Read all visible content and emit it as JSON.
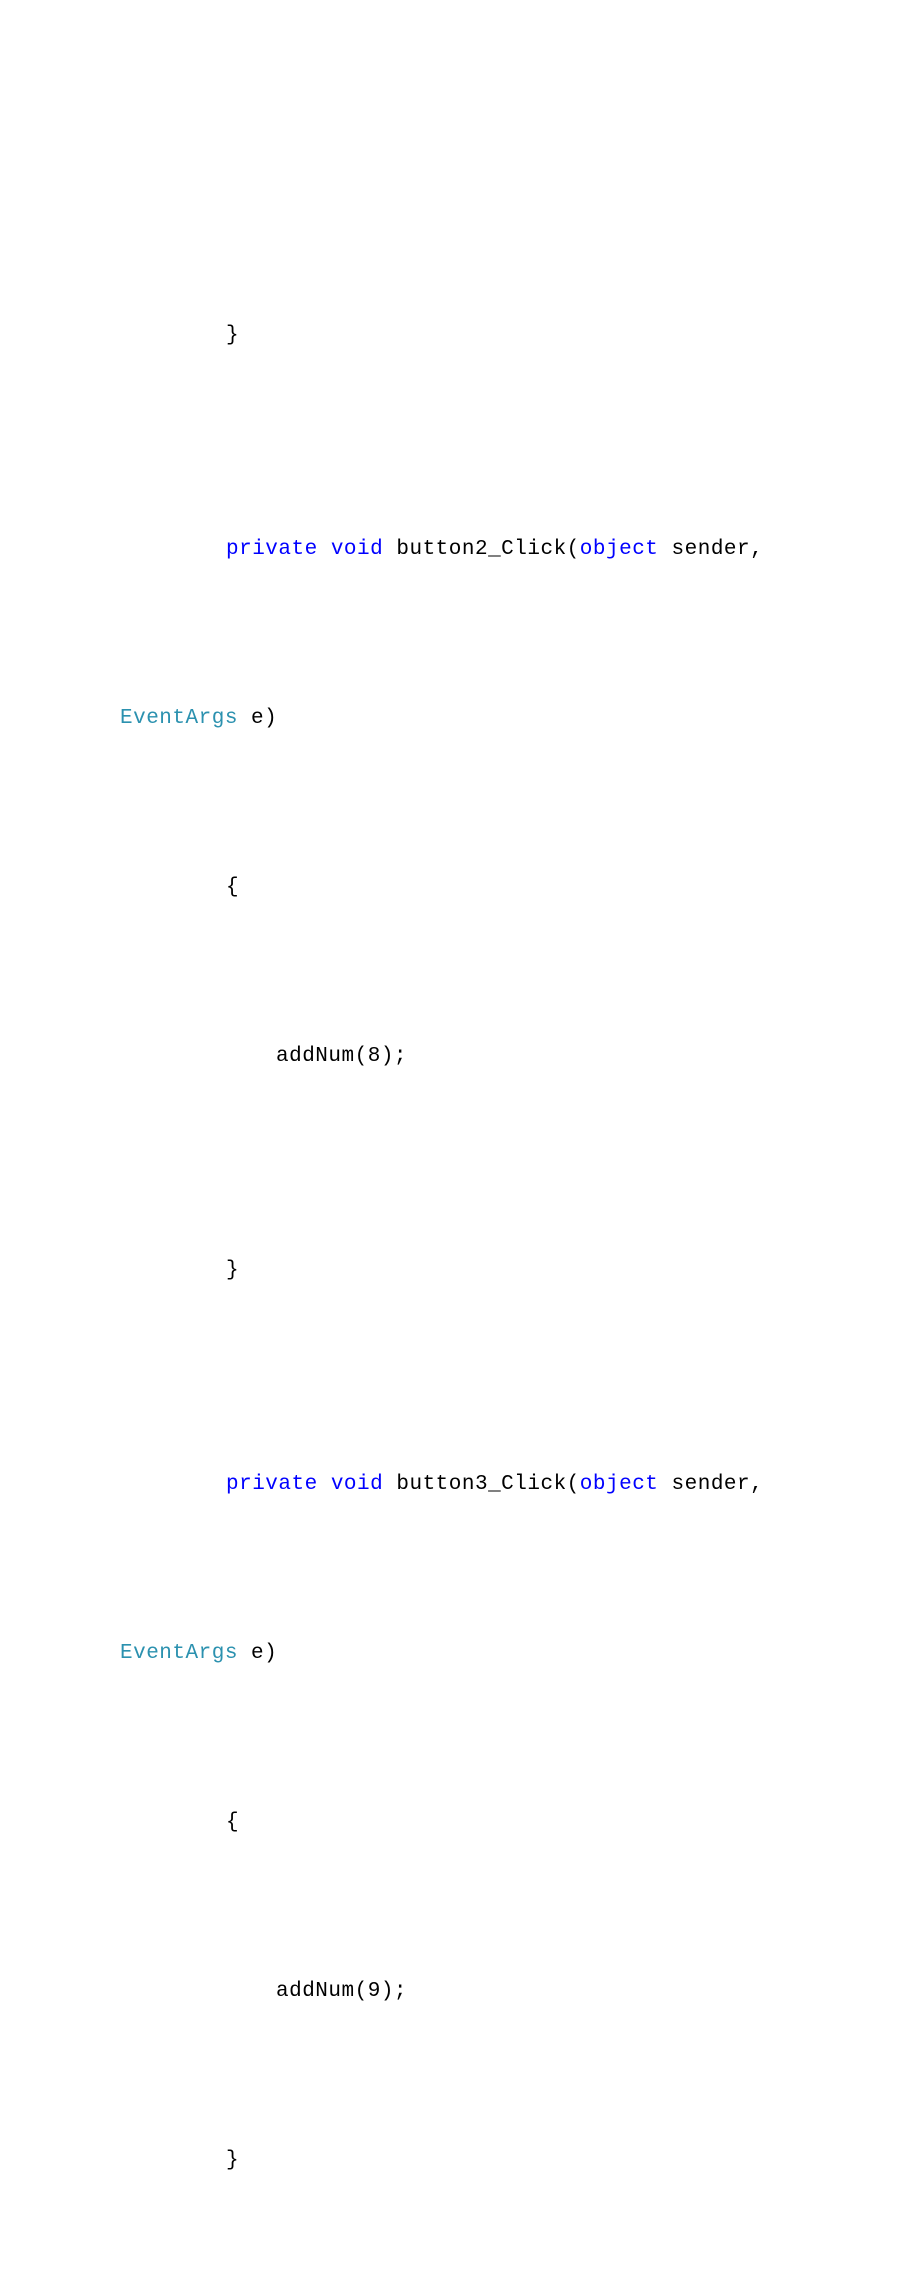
{
  "code": {
    "line1": "}",
    "method2": {
      "kw_private": "private",
      "kw_void": "void",
      "name": "button2_Click(",
      "kw_object": "object",
      "sender": " sender, ",
      "eventargs": "EventArgs",
      "param_end": " e)",
      "open_brace": "{",
      "body": "addNum(8);",
      "close_brace": "}"
    },
    "method3": {
      "kw_private": "private",
      "kw_void": "void",
      "name": "button3_Click(",
      "kw_object": "object",
      "sender": " sender, ",
      "eventargs": "EventArgs",
      "param_end": " e)",
      "open_brace": "{",
      "body": "addNum(9);",
      "close_brace": "}"
    }
  }
}
